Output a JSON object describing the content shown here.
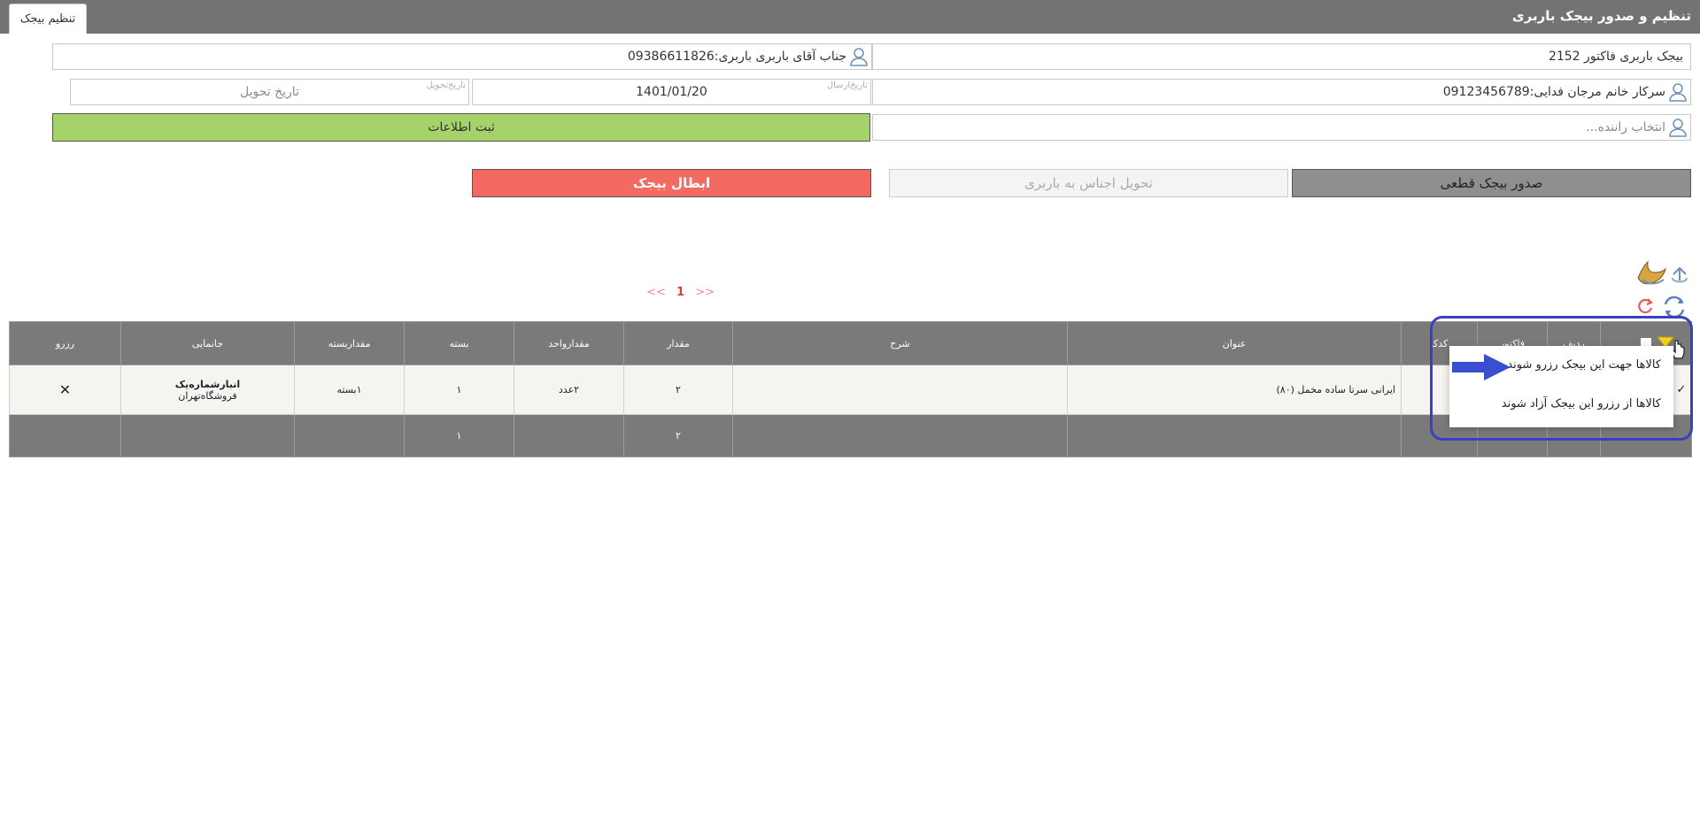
{
  "header": {
    "title": "تنظیم و صدور بیجک باربری",
    "tab_label": "تنظیم بیجک"
  },
  "form": {
    "invoice": "بیجک باربری فاکتور 2152",
    "carrier": "جناب آقای باربری باربری:09386611826",
    "customer": "سرکار خانم مرجان فدایی:09123456789",
    "send_date_label": "تاریخ‌ارسال",
    "send_date": "1401/01/20",
    "delivery_date_label": "تاریخ‌تحویل",
    "delivery_date_placeholder": "تاریخ تحویل",
    "driver_placeholder": "انتخاب راننده...",
    "save_label": "ثبت اطلاعات"
  },
  "actions": {
    "final_label": "صدور بیجک قطعی",
    "deliver_label": "تحویل اجناس به باربری",
    "cancel_label": "ابطال بیجک"
  },
  "pager": {
    "prev": "<<",
    "current": "1",
    "next": ">>"
  },
  "table": {
    "headers": {
      "radif": "ردیف",
      "factor": "فاکتور",
      "code": "کدکا",
      "title": "عنوان",
      "desc": "شرح",
      "qty": "مقدار",
      "unit_qty": "مقدارواحد",
      "pack": "بسته",
      "pack_qty": "مقداربسته",
      "location": "جانمایی",
      "reserve": "رزرو"
    },
    "row": {
      "title": "ایرانی سرتا ساده مخمل (۸۰)",
      "qty": "۲",
      "unit_qty": "۲عدد",
      "pack": "۱",
      "pack_qty": "۱بسته",
      "location_1": "انبارشماره‌یک",
      "location_2": "فروشگاه‌تهران",
      "reserve": "✕"
    },
    "total": {
      "qty": "۲",
      "pack": "۱"
    }
  },
  "popup": {
    "item_reserve": "کالاها جهت این بیجک رزرو شوند",
    "item_release": "کالاها از رزرو این بیجک آزاد شوند"
  },
  "colors": {
    "titlebar": "#737373",
    "save": "#a6d26a",
    "final": "#8f8f8f",
    "cancel": "#f26a62",
    "highlight": "#3a3fc4"
  }
}
